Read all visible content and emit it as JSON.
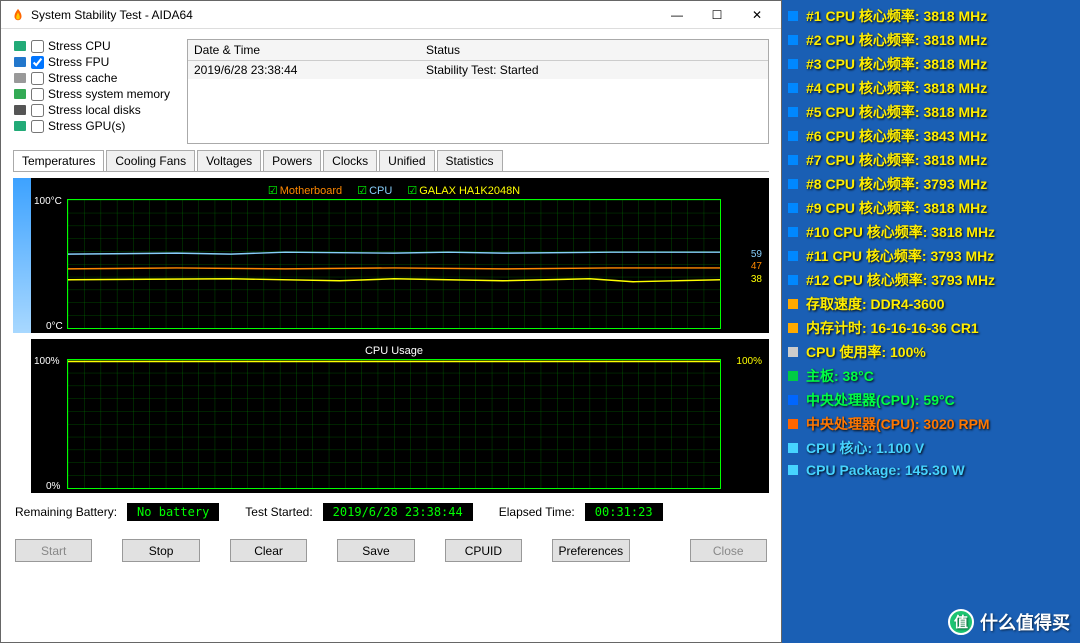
{
  "window": {
    "title": "System Stability Test - AIDA64",
    "min": "—",
    "max": "☐",
    "close": "✕"
  },
  "stress": {
    "items": [
      {
        "label": "Stress CPU",
        "checked": false,
        "icon": "cpu"
      },
      {
        "label": "Stress FPU",
        "checked": true,
        "icon": "fpu"
      },
      {
        "label": "Stress cache",
        "checked": false,
        "icon": "cache"
      },
      {
        "label": "Stress system memory",
        "checked": false,
        "icon": "mem"
      },
      {
        "label": "Stress local disks",
        "checked": false,
        "icon": "disk"
      },
      {
        "label": "Stress GPU(s)",
        "checked": false,
        "icon": "gpu"
      }
    ]
  },
  "log": {
    "headers": [
      "Date & Time",
      "Status"
    ],
    "rows": [
      [
        "2019/6/28 23:38:44",
        "Stability Test: Started"
      ]
    ]
  },
  "tabs": [
    "Temperatures",
    "Cooling Fans",
    "Voltages",
    "Powers",
    "Clocks",
    "Unified",
    "Statistics"
  ],
  "active_tab": "Temperatures",
  "temp_chart": {
    "title_legend": {
      "motherboard": "Motherboard",
      "cpu": "CPU",
      "galax": "GALAX HA1K2048N"
    },
    "y_top": "100°C",
    "y_bot": "0°C",
    "r_labels": [
      {
        "val": "59",
        "pct": 41,
        "cls": "c-blue"
      },
      {
        "val": "47",
        "pct": 53,
        "cls": "c-orange"
      },
      {
        "val": "38",
        "pct": 62,
        "cls": "c-yellow"
      }
    ]
  },
  "cpu_chart": {
    "title": "CPU Usage",
    "y_top": "100%",
    "y_bot": "0%",
    "r_label": "100%"
  },
  "statusbar": {
    "batt_lbl": "Remaining Battery:",
    "batt_val": "No battery",
    "start_lbl": "Test Started:",
    "start_val": "2019/6/28 23:38:44",
    "elapsed_lbl": "Elapsed Time:",
    "elapsed_val": "00:31:23"
  },
  "buttons": {
    "start": "Start",
    "stop": "Stop",
    "clear": "Clear",
    "save": "Save",
    "cpuid": "CPUID",
    "prefs": "Preferences",
    "close": "Close"
  },
  "overlay": {
    "cpu_cores": [
      {
        "label": "#1 CPU 核心频率: 3818 MHz"
      },
      {
        "label": "#2 CPU 核心频率: 3818 MHz"
      },
      {
        "label": "#3 CPU 核心频率: 3818 MHz"
      },
      {
        "label": "#4 CPU 核心频率: 3818 MHz"
      },
      {
        "label": "#5 CPU 核心频率: 3818 MHz"
      },
      {
        "label": "#6 CPU 核心频率: 3843 MHz"
      },
      {
        "label": "#7 CPU 核心频率: 3818 MHz"
      },
      {
        "label": "#8 CPU 核心频率: 3793 MHz"
      },
      {
        "label": "#9 CPU 核心频率: 3818 MHz"
      },
      {
        "label": "#10 CPU 核心频率: 3818 MHz"
      },
      {
        "label": "#11 CPU 核心频率: 3793 MHz"
      },
      {
        "label": "#12 CPU 核心频率: 3793 MHz"
      }
    ],
    "rows": [
      {
        "label": "存取速度: DDR4-3600",
        "cls": "ov-yellow",
        "ico": "#ffaa00"
      },
      {
        "label": "内存计时: 16-16-16-36 CR1",
        "cls": "ov-yellow",
        "ico": "#ffaa00"
      },
      {
        "label": "CPU 使用率: 100%",
        "cls": "ov-yellow",
        "ico": "#ccc"
      },
      {
        "label": "主板: 38°C",
        "cls": "ov-green",
        "ico": "#00cc44"
      },
      {
        "label": "中央处理器(CPU): 59°C",
        "cls": "ov-green",
        "ico": "#0066ff"
      },
      {
        "label": "中央处理器(CPU): 3020 RPM",
        "cls": "ov-orange",
        "ico": "#ff6600"
      },
      {
        "label": "CPU 核心: 1.100 V",
        "cls": "ov-cyan",
        "ico": "#46d4ff"
      },
      {
        "label": "CPU Package: 145.30 W",
        "cls": "ov-cyan",
        "ico": "#46d4ff"
      }
    ]
  },
  "watermark": "什么值得买",
  "chart_data": [
    {
      "type": "line",
      "title": "Temperatures",
      "ylabel": "°C",
      "ylim": [
        0,
        100
      ],
      "series": [
        {
          "name": "CPU",
          "current": 59,
          "color": "#87cefa"
        },
        {
          "name": "Motherboard",
          "current": 47,
          "color": "#ff8800"
        },
        {
          "name": "GALAX HA1K2048N",
          "current": 38,
          "color": "#ffff00"
        }
      ]
    },
    {
      "type": "line",
      "title": "CPU Usage",
      "ylabel": "%",
      "ylim": [
        0,
        100
      ],
      "series": [
        {
          "name": "CPU Usage",
          "current": 100,
          "color": "#ffff00"
        }
      ]
    }
  ]
}
